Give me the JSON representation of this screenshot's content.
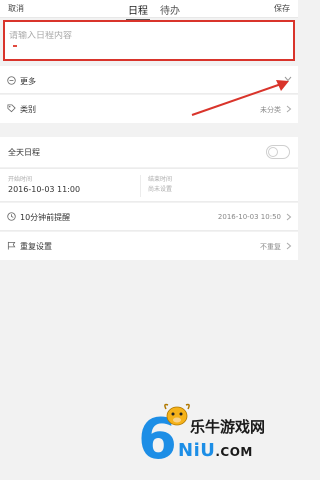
{
  "header": {
    "cancel_label": "取消",
    "tabs": [
      {
        "label": "日程",
        "active": true
      },
      {
        "label": "待办",
        "active": false
      }
    ],
    "save_label": "保存"
  },
  "title_input": {
    "value": "",
    "placeholder": "请输入日程内容"
  },
  "more": {
    "label": "更多"
  },
  "category": {
    "label": "类别",
    "value": "未分类"
  },
  "all_day": {
    "label": "全天日程",
    "enabled": false
  },
  "start": {
    "caption": "开始时间",
    "value": "2016-10-03 11:00"
  },
  "end": {
    "caption": "结束时间",
    "value": "尚未设置"
  },
  "reminder": {
    "label": "10分钟前提醒",
    "value": "2016-10-03 10:50"
  },
  "repeat": {
    "label": "重复设置",
    "value": "不重复"
  },
  "watermark": {
    "site_name": "乐牛游戏网",
    "domain": ".COM",
    "number": "6",
    "brand": "NiU"
  },
  "colors": {
    "highlight_box": "#d9342b",
    "arrow": "#d9342b",
    "logo_blue": "#1d8ee6"
  }
}
